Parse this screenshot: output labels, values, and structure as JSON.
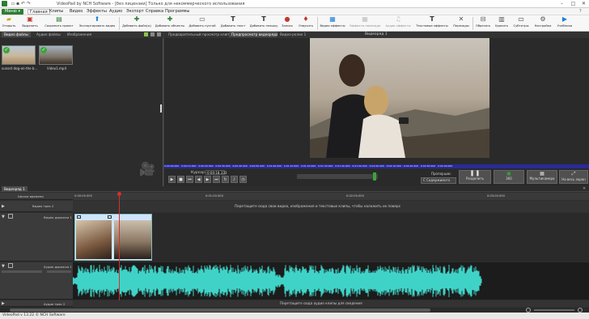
{
  "app": {
    "title": "VideoPad by NCH Software - [без лицензии] Только для некоммерческого использования",
    "status": "VideoPad v 13.22 © NCH Software"
  },
  "menu": {
    "home_btn": "Меню ▾",
    "items": [
      "Главная",
      "Клипы",
      "Видео",
      "Эффекты",
      "Аудио",
      "Экспорт",
      "Справка",
      "Программы"
    ]
  },
  "toolbar": {
    "buttons": [
      "Открыть",
      "Выделить",
      "Сохранить проект",
      "Экспортировать видео",
      "Добавить файл(ы)",
      "Добавить объекты",
      "Добавить пустой",
      "Добавить текст",
      "Добавить плашку",
      "Запись",
      "Озвучить",
      "Видео эффекты",
      "Эффекты перехода",
      "Аудио эффекты",
      "Текстовые эффекты",
      "Переходы",
      "Обрезать",
      "Удалить",
      "Субтитры",
      "Настройки",
      "Учебники"
    ]
  },
  "media": {
    "tabs": [
      "Видео файлы",
      "Аудио файлы",
      "Изображения"
    ],
    "files": [
      "sunset dog-on-the b...",
      "Video1.mp4"
    ]
  },
  "preview": {
    "tabs": [
      "Предварительный просмотр клипа",
      "Предпросмотр видеоряда",
      "Видео-ролик 1"
    ],
    "title": "Видеоряд 1",
    "cursor_label": "Курсор:",
    "cursor_value": "0:00:18.333",
    "ruler": [
      "0:00:00.000",
      "0:00:10.000",
      "0:00:20.000",
      "0:00:30.000",
      "0:00:40.000",
      "0:00:50.000",
      "0:01:00.000",
      "0:01:10.000",
      "0:01:20.000",
      "0:01:30.000",
      "0:01:40.000",
      "0:01:50.000",
      "0:02:00.000",
      "0:02:10.000",
      "0:02:20.000",
      "0:02:30.000",
      "0:02:40.000"
    ],
    "ratio_label": "Пропорции:",
    "ratio_value": "С Содержимого",
    "split": "Разделить",
    "fx360": "360",
    "multicam": "Мультикамера",
    "fullscreen": "На весь экран"
  },
  "timeline": {
    "tab": "Видеоряд 1",
    "scale": "Шкала времени",
    "ruler": [
      "0:00:00.000",
      "0:01:00.000",
      "0:02:00.000",
      "0:03:00.000"
    ],
    "overlay_track": "Видео трек 2",
    "overlay_hint": "Перетащите сюда свои видео, изображения и текстовые клипы, чтобы наложить их поверх",
    "video_track": "Видео дорожка 1",
    "audio_track": "Аудио дорожка 1",
    "audio_track2": "Аудио трек 2",
    "audio_hint": "Перетащите сюда аудио клипы для сведения"
  },
  "colors": {
    "accent": "#2e7d32",
    "wave": "#3fd3c8",
    "playhead": "#d32f2f",
    "blue": "#2a2a9a"
  }
}
